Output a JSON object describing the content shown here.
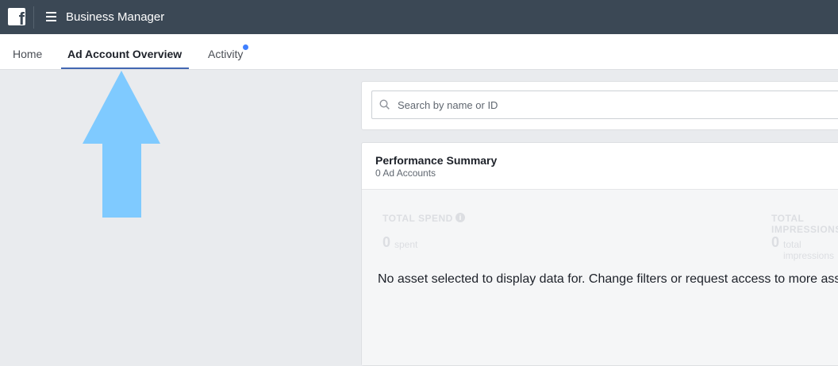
{
  "header": {
    "app_title": "Business Manager",
    "logo_icon": "facebook-logo-icon",
    "menu_icon": "hamburger-menu-icon",
    "bg_color": "#3b4855"
  },
  "tabs": [
    {
      "label": "Home",
      "active": false
    },
    {
      "label": "Ad Account Overview",
      "active": true
    },
    {
      "label": "Activity",
      "active": false,
      "has_notification": true
    }
  ],
  "annotation": {
    "icon": "up-arrow-icon",
    "color": "#7fcaff"
  },
  "search": {
    "placeholder": "Search by name or ID",
    "value": "",
    "icon": "search-icon"
  },
  "performance": {
    "title": "Performance Summary",
    "subtitle": "0 Ad Accounts",
    "metrics": [
      {
        "label": "TOTAL SPEND",
        "value": "0",
        "unit": "spent",
        "info_icon": "info-icon"
      },
      {
        "label": "TOTAL IMPRESSIONS",
        "value": "0",
        "unit": "total impressions"
      }
    ],
    "empty_message": "No asset selected to display data for. Change filters or request access to more assets."
  }
}
